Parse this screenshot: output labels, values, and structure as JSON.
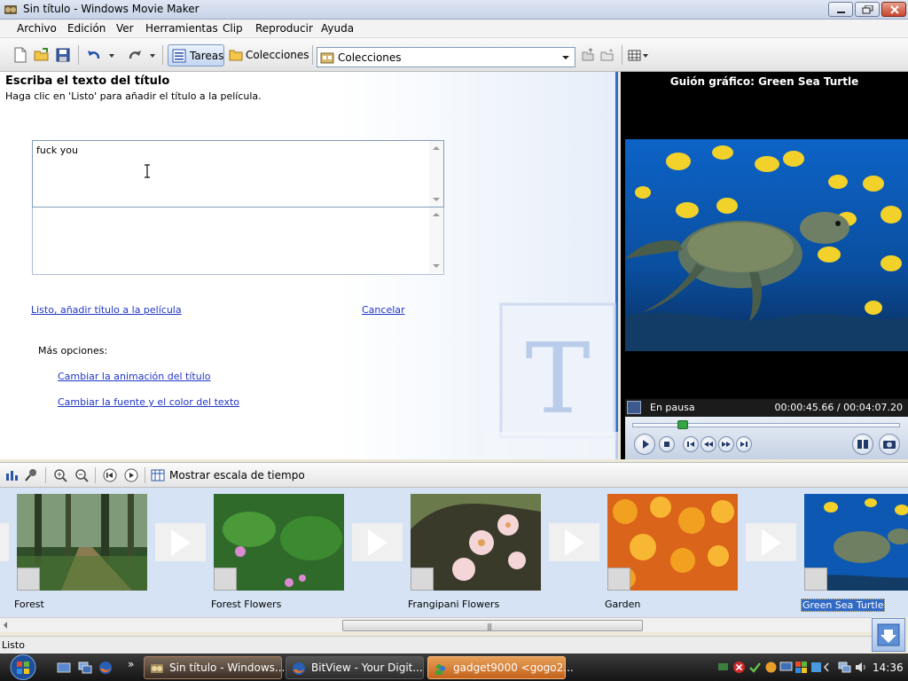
{
  "window": {
    "title": "Sin título - Windows Movie Maker"
  },
  "menu": [
    "Archivo",
    "Edición",
    "Ver",
    "Herramientas",
    "Clip",
    "Reproducir",
    "Ayuda"
  ],
  "toolbar": {
    "tasks_label": "Tareas",
    "collections_label": "Colecciones",
    "collections_select_value": "Colecciones"
  },
  "task_pane": {
    "heading": "Escriba el texto del título",
    "subtitle": "Haga clic en 'Listo' para añadir el título a la película.",
    "title_text": "fuck you",
    "second_text": "",
    "done_link": "Listo, añadir título a la película",
    "cancel_link": "Cancelar",
    "more_options_label": "Más opciones:",
    "change_animation_link": "Cambiar la animación del título",
    "change_font_link": "Cambiar la fuente y el color del texto"
  },
  "preview": {
    "title": "Guión gráfico: Green Sea Turtle",
    "state": "En pausa",
    "time": "00:00:45.66 / 00:04:07.20",
    "seek_position": 0.19
  },
  "storyboard_toolbar": {
    "timeline_label": "Mostrar escala de tiempo"
  },
  "storyboard": {
    "clips": [
      {
        "label": "Forest"
      },
      {
        "label": "Forest Flowers"
      },
      {
        "label": "Frangipani Flowers"
      },
      {
        "label": "Garden"
      },
      {
        "label": "Green Sea Turtle",
        "selected": true
      }
    ]
  },
  "status": {
    "text": "Listo"
  },
  "taskbar": {
    "items": [
      {
        "label": "Sin título - Windows..."
      },
      {
        "label": "BitView - Your Digit..."
      },
      {
        "label": "gadget9000 <gogo2..."
      }
    ],
    "clock": "14:36"
  },
  "colors": {
    "accent_blue": "#2f6bd2",
    "link": "#1f36c8",
    "storyboard_bg": "#d5e3f4"
  }
}
